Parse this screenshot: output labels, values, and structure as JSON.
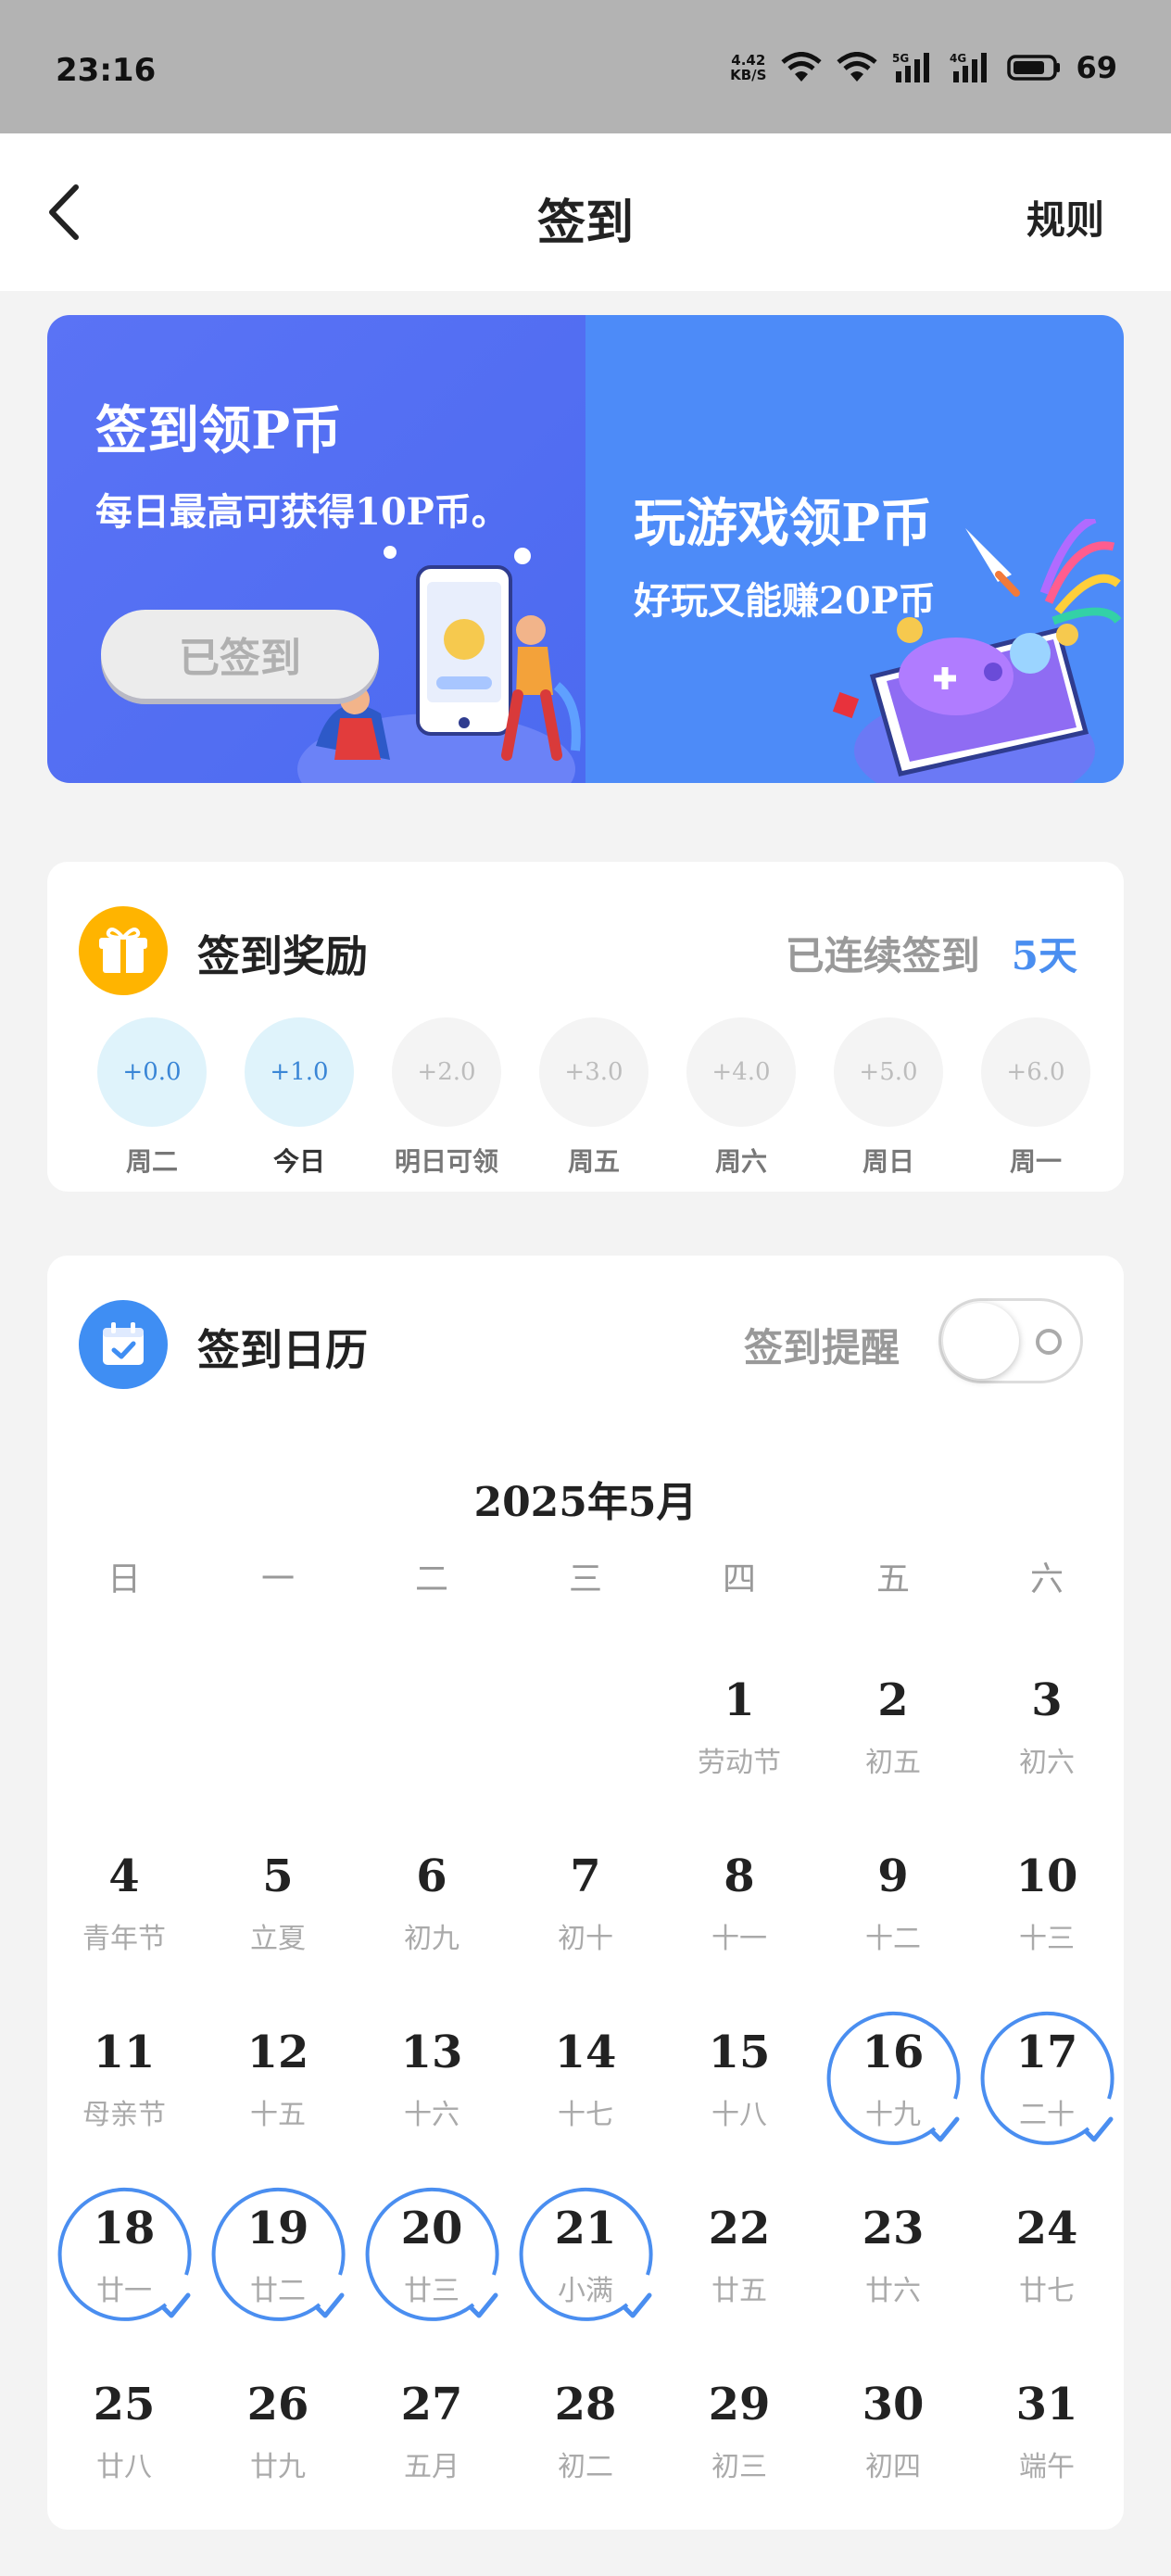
{
  "status_bar": {
    "time": "23:16",
    "net_speed_value": "4.42",
    "net_speed_unit": "KB/S",
    "battery_level": "69",
    "icons": [
      "wifi-icon",
      "wifi-icon",
      "signal-5g-icon",
      "signal-4g-icon",
      "battery-icon"
    ]
  },
  "header": {
    "title": "签到",
    "rules_label": "规则"
  },
  "banner": {
    "left_title": "签到领P币",
    "left_subtitle": "每日最高可获得10P币。",
    "signed_button": "已签到",
    "right_title": "玩游戏领P币",
    "right_subtitle": "好玩又能赚20P币",
    "colors": {
      "left_bg": "#5a73f5",
      "right_bg": "#4d8bf8"
    }
  },
  "reward": {
    "title": "签到奖励",
    "streak_label": "已连续签到",
    "streak_days": "5天",
    "days": [
      {
        "amount": "+0.0",
        "label": "周二",
        "claimed": true
      },
      {
        "amount": "+1.0",
        "label": "今日",
        "claimed": true
      },
      {
        "amount": "+2.0",
        "label": "明日可领",
        "claimed": false
      },
      {
        "amount": "+3.0",
        "label": "周五",
        "claimed": false
      },
      {
        "amount": "+4.0",
        "label": "周六",
        "claimed": false
      },
      {
        "amount": "+5.0",
        "label": "周日",
        "claimed": false
      },
      {
        "amount": "+6.0",
        "label": "周一",
        "claimed": false
      }
    ],
    "colors": {
      "accent": "#4a8ef0",
      "gift_icon_bg": "#ffb400"
    }
  },
  "calendar": {
    "title": "签到日历",
    "reminder_label": "签到提醒",
    "reminder_on": false,
    "month": "2025年5月",
    "weekdays": [
      "日",
      "一",
      "二",
      "三",
      "四",
      "五",
      "六"
    ],
    "first_weekday_index": 4,
    "days": [
      {
        "day": "1",
        "lunar": "劳动节",
        "signed": false
      },
      {
        "day": "2",
        "lunar": "初五",
        "signed": false
      },
      {
        "day": "3",
        "lunar": "初六",
        "signed": false
      },
      {
        "day": "4",
        "lunar": "青年节",
        "signed": false
      },
      {
        "day": "5",
        "lunar": "立夏",
        "signed": false
      },
      {
        "day": "6",
        "lunar": "初九",
        "signed": false
      },
      {
        "day": "7",
        "lunar": "初十",
        "signed": false
      },
      {
        "day": "8",
        "lunar": "十一",
        "signed": false
      },
      {
        "day": "9",
        "lunar": "十二",
        "signed": false
      },
      {
        "day": "10",
        "lunar": "十三",
        "signed": false
      },
      {
        "day": "11",
        "lunar": "母亲节",
        "signed": false
      },
      {
        "day": "12",
        "lunar": "十五",
        "signed": false
      },
      {
        "day": "13",
        "lunar": "十六",
        "signed": false
      },
      {
        "day": "14",
        "lunar": "十七",
        "signed": false
      },
      {
        "day": "15",
        "lunar": "十八",
        "signed": false
      },
      {
        "day": "16",
        "lunar": "十九",
        "signed": true
      },
      {
        "day": "17",
        "lunar": "二十",
        "signed": true
      },
      {
        "day": "18",
        "lunar": "廿一",
        "signed": true
      },
      {
        "day": "19",
        "lunar": "廿二",
        "signed": true
      },
      {
        "day": "20",
        "lunar": "廿三",
        "signed": true
      },
      {
        "day": "21",
        "lunar": "小满",
        "signed": true
      },
      {
        "day": "22",
        "lunar": "廿五",
        "signed": false
      },
      {
        "day": "23",
        "lunar": "廿六",
        "signed": false
      },
      {
        "day": "24",
        "lunar": "廿七",
        "signed": false
      },
      {
        "day": "25",
        "lunar": "廿八",
        "signed": false
      },
      {
        "day": "26",
        "lunar": "廿九",
        "signed": false
      },
      {
        "day": "27",
        "lunar": "五月",
        "signed": false
      },
      {
        "day": "28",
        "lunar": "初二",
        "signed": false
      },
      {
        "day": "29",
        "lunar": "初三",
        "signed": false
      },
      {
        "day": "30",
        "lunar": "初四",
        "signed": false
      },
      {
        "day": "31",
        "lunar": "端午",
        "signed": false
      }
    ],
    "colors": {
      "signed_ring": "#4a8ef0",
      "calendar_icon_bg": "#3f8ef3"
    }
  }
}
